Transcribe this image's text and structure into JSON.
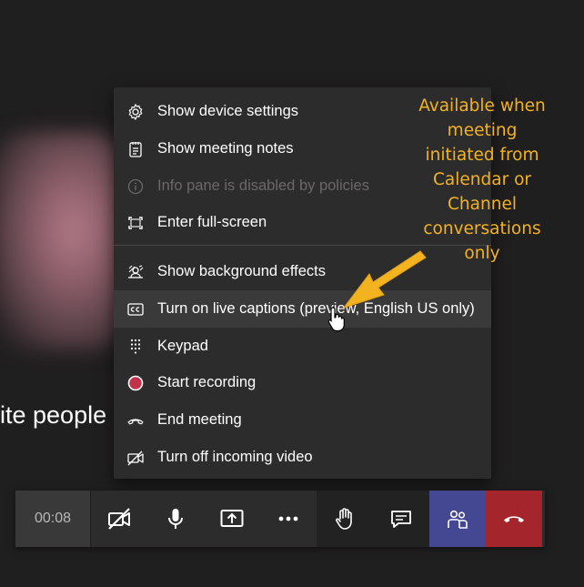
{
  "background": {
    "partial_text": "ite people"
  },
  "menu": {
    "items": [
      {
        "label": "Show device settings",
        "icon": "gear-icon",
        "disabled": false
      },
      {
        "label": "Show meeting notes",
        "icon": "notes-icon",
        "disabled": false
      },
      {
        "label": "Info pane is disabled by policies",
        "icon": "info-icon",
        "disabled": true
      },
      {
        "label": "Enter full-screen",
        "icon": "fullscreen-icon",
        "disabled": false
      },
      {
        "label": "Show background effects",
        "icon": "background-effects-icon",
        "disabled": false
      },
      {
        "label": "Turn on live captions (preview, English US only)",
        "icon": "closed-captions-icon",
        "disabled": false,
        "hovered": true
      },
      {
        "label": "Keypad",
        "icon": "keypad-icon",
        "disabled": false
      },
      {
        "label": "Start recording",
        "icon": "record-icon",
        "disabled": false
      },
      {
        "label": "End meeting",
        "icon": "phone-icon",
        "disabled": false
      },
      {
        "label": "Turn off incoming video",
        "icon": "video-off-icon",
        "disabled": false
      }
    ]
  },
  "annotation": {
    "lines": [
      "Available when",
      "meeting",
      "initiated from",
      "Calendar or",
      "Channel",
      "conversations",
      "only"
    ],
    "color": "#f3b21f"
  },
  "toolbar": {
    "timer": "00:08",
    "buttons": [
      "camera-off-icon",
      "microphone-icon",
      "share-screen-icon",
      "more-options-icon",
      "raise-hand-icon",
      "chat-icon",
      "participants-icon",
      "hang-up-icon"
    ],
    "colors": {
      "participants": "#444791",
      "hangup": "#a4262c"
    }
  }
}
